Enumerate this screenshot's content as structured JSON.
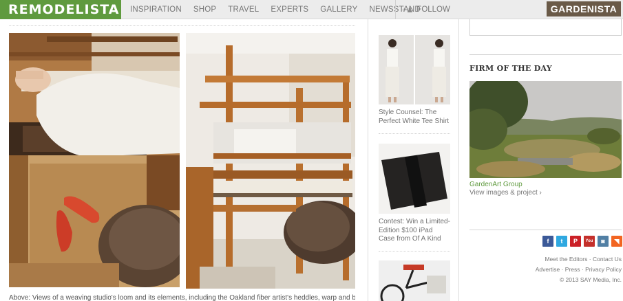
{
  "header": {
    "logo": "REMODELISTA",
    "nav": [
      "INSPIRATION",
      "SHOP",
      "TRAVEL",
      "EXPERTS",
      "GALLERY",
      "NEWSSTAND"
    ],
    "follow_label": "FOLLOW",
    "sister_site": "GARDENISTA"
  },
  "article": {
    "caption_partial": "Above: Views of a weaving studio's loom and its elements, including the Oakland fiber artist's heddles, warp and bench cushion."
  },
  "sidebar_middle": {
    "items": [
      {
        "caption": "Style Counsel: The Perfect White Tee Shirt"
      },
      {
        "caption": "Contest: Win a Limited-Edition $100 iPad Case from Of A Kind"
      }
    ]
  },
  "sidebar_right": {
    "firm_heading": "FIRM OF THE DAY",
    "firm_name": "GardenArt Group",
    "firm_link": "View images & project",
    "firm_link_arrow": "›",
    "social": [
      {
        "name": "facebook-icon",
        "glyph": "f",
        "color": "#3b5998"
      },
      {
        "name": "twitter-icon",
        "glyph": "t",
        "color": "#2fa8e0"
      },
      {
        "name": "pinterest-icon",
        "glyph": "P",
        "color": "#cb2027"
      },
      {
        "name": "youtube-icon",
        "glyph": "You",
        "color": "#c4302b"
      },
      {
        "name": "instagram-icon",
        "glyph": "◙",
        "color": "#517fa4"
      },
      {
        "name": "rss-icon",
        "glyph": "◥",
        "color": "#f26522"
      }
    ],
    "footer": {
      "meet_editors": "Meet the Editors",
      "contact_us": "Contact Us",
      "advertise": "Advertise",
      "press": "Press",
      "privacy_policy": "Privacy Policy",
      "copyright": "© 2013 SAY Media, Inc.",
      "separator": "·"
    }
  }
}
